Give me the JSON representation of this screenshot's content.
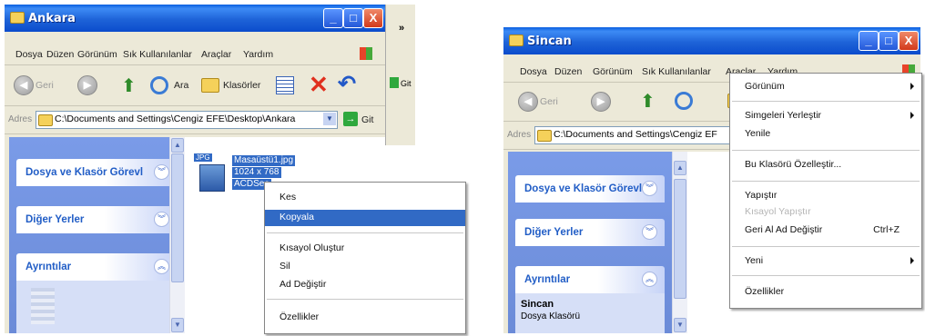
{
  "left_window": {
    "title": "Ankara",
    "caption_buttons": {
      "minimize": "_",
      "maximize": "□",
      "close": "X"
    },
    "menu": [
      "Dosya",
      "Düzen",
      "Görünüm",
      "Sık Kullanılanlar",
      "Araçlar",
      "Yardım"
    ],
    "toolbar": {
      "back_label": "Geri",
      "search_label": "Ara",
      "folders_label": "Klasörler"
    },
    "overflow_chevron": "»",
    "go_label": "Git",
    "address": {
      "label": "Adres",
      "path": "C:\\Documents and Settings\\Cengiz EFE\\Desktop\\Ankara",
      "go": "Git"
    },
    "task_pane": [
      "Dosya ve Klasör Görevl",
      "Diğer Yerler",
      "Ayrıntılar"
    ],
    "file": {
      "icon_text": "JPG",
      "name": "Masaüstü1.jpg",
      "dimensions": "1024 x 768",
      "app": "ACDSee"
    },
    "context_menu": {
      "items": [
        {
          "label": "Kes",
          "highlighted": false
        },
        {
          "label": "Kopyala",
          "highlighted": true
        },
        {
          "label": "Kısayol Oluştur",
          "highlighted": false
        },
        {
          "label": "Sil",
          "highlighted": false
        },
        {
          "label": "Ad Değiştir",
          "highlighted": false
        },
        {
          "label": "Özellikler",
          "highlighted": false
        }
      ]
    }
  },
  "right_window": {
    "title": "Sincan",
    "caption_buttons": {
      "minimize": "_",
      "maximize": "□",
      "close": "X"
    },
    "menu": [
      "Dosya",
      "Düzen",
      "Görünüm",
      "Sık Kullanılanlar",
      "Araçlar",
      "Yardım"
    ],
    "toolbar": {
      "back_label": "Geri"
    },
    "address": {
      "label": "Adres",
      "path": "C:\\Documents and Settings\\Cengiz EF"
    },
    "task_pane": [
      "Dosya ve Klasör Görevl",
      "Diğer Yerler",
      "Ayrıntılar"
    ],
    "details": {
      "name": "Sincan",
      "type": "Dosya Klasörü"
    },
    "context_menu": {
      "items": [
        {
          "label": "Görünüm",
          "submenu": true
        },
        {
          "label": "Simgeleri Yerleştir",
          "submenu": true
        },
        {
          "label": "Yenile"
        },
        {
          "label": "Bu Klasörü Özelleştir..."
        },
        {
          "label": "Yapıştır"
        },
        {
          "label": "Kısayol Yapıştır",
          "disabled": true
        },
        {
          "label": "Geri Al Ad Değiştir",
          "shortcut": "Ctrl+Z"
        },
        {
          "label": "Yeni",
          "submenu": true
        },
        {
          "label": "Özellikler"
        }
      ]
    }
  },
  "colors": {
    "xp_blue": "#0b4ccc",
    "selection": "#316ac5",
    "task_header": "#215dc6",
    "window_bg": "#ece9d8"
  }
}
